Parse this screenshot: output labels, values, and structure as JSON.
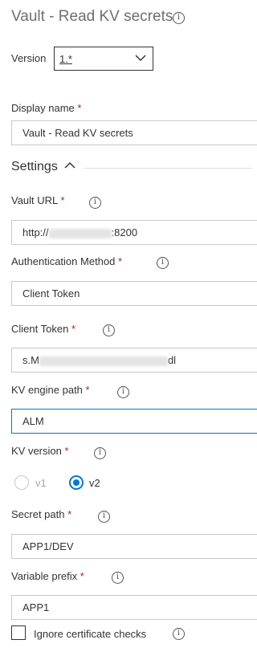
{
  "task": {
    "title": "Vault - Read KV secrets",
    "version_label": "Version",
    "version_value": "1.*"
  },
  "display_name": {
    "label": "Display name",
    "required_mark": "*",
    "value": "Vault - Read KV secrets"
  },
  "settings": {
    "section_label": "Settings",
    "vault_url": {
      "label": "Vault URL",
      "value_prefix": "http://",
      "value_suffix": ":8200"
    },
    "auth_method": {
      "label": "Authentication Method",
      "value": "Client Token"
    },
    "client_token": {
      "label": "Client Token",
      "value_prefix": "s.M",
      "value_suffix": "dl"
    },
    "kv_engine_path": {
      "label": "KV engine path",
      "value": "ALM"
    },
    "kv_version": {
      "label": "KV version",
      "options": [
        {
          "label": "v1",
          "selected": false
        },
        {
          "label": "v2",
          "selected": true
        }
      ]
    },
    "secret_path": {
      "label": "Secret path",
      "value": "APP1/DEV"
    },
    "variable_prefix": {
      "label": "Variable prefix",
      "value": "APP1"
    },
    "ignore_cert": {
      "label": "Ignore certificate checks",
      "checked": false
    }
  },
  "colors": {
    "accent": "#0078d4",
    "required": "#a4262c",
    "border": "#c8c8c8"
  },
  "icons": {
    "info": "info-icon",
    "chevron_down": "chevron-down-icon",
    "chevron_up": "chevron-up-icon"
  }
}
